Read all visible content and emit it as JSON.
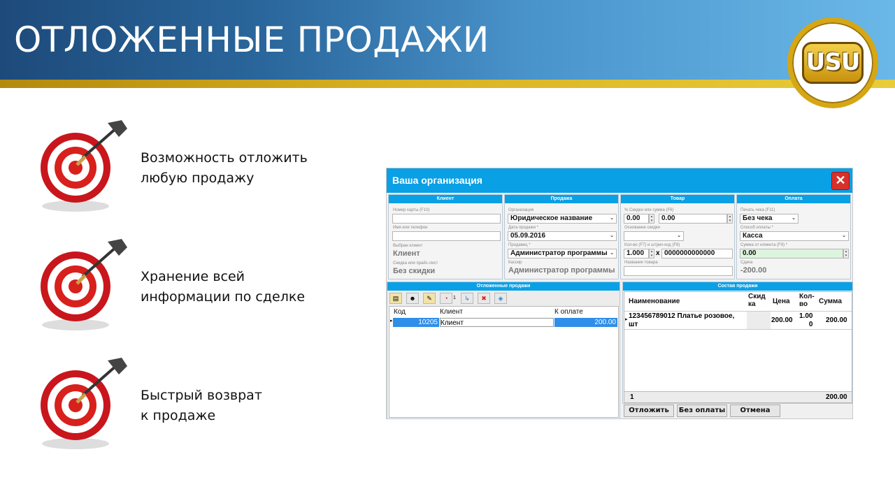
{
  "slide": {
    "title": "ОТЛОЖЕННЫЕ ПРОДАЖИ",
    "logo_text": "USU",
    "features": [
      {
        "line1": "Возможность отложить",
        "line2": "любую продажу"
      },
      {
        "line1": "Хранение всей",
        "line2": "информации по сделке"
      },
      {
        "line1": "Быстрый возврат",
        "line2": "к продаже"
      }
    ]
  },
  "app": {
    "title": "Ваша организация",
    "close_icon": "✕",
    "client": {
      "header": "Клиент",
      "card_label": "Номер карты (F10)",
      "card_value": "",
      "name_label": "Имя или телефон",
      "name_value": "",
      "selected_label": "Выбран клиент",
      "selected_value": "Клиент",
      "discount_label": "Скидка или прайс-лист",
      "discount_value": "Без скидки"
    },
    "sale": {
      "header": "Продажа",
      "org_label": "Организация",
      "org_value": "Юридическое название",
      "date_label": "Дата продажи *",
      "date_value": "05.09.2016",
      "seller_label": "Продавец *",
      "seller_value": "Администратор программы",
      "cashier_label": "Кассир",
      "cashier_value": "Администратор программы"
    },
    "goods": {
      "header": "Товар",
      "discount_label": "% Скидки или сумма (F6)",
      "discount_pct": "0.00",
      "discount_sum": "0.00",
      "reason_label": "Основание скидки",
      "reason_value": "",
      "qty_label": "Кол-во (F7) и штрих-код (F8)",
      "qty_value": "1.000",
      "barcode_value": "0000000000000",
      "name_label": "Название товара",
      "name_value": ""
    },
    "payment": {
      "header": "Оплата",
      "print_label": "Печать чека (F11)",
      "print_value": "Без чека",
      "method_label": "Способ оплаты *",
      "method_value": "Касса",
      "amount_label": "Сумма от клиента (F9) *",
      "amount_value": "0.00",
      "change_label": "Сдача",
      "change_value": "-200.00"
    },
    "deferred": {
      "header": "Отложенные продажи",
      "toolbar_count": "1",
      "columns": [
        "Код",
        "Клиент",
        "К оплате"
      ],
      "rows": [
        {
          "code": "10205",
          "client": "Клиент",
          "amount": "200.00"
        }
      ]
    },
    "composition": {
      "header": "Состав продажи",
      "columns": [
        "Наименование",
        "Скид\nка",
        "Цена",
        "Кол-\nво",
        "Сумма"
      ],
      "rows": [
        {
          "name": "123456789012 Платье розовое,\nшт",
          "discount": "",
          "price": "200.00",
          "qty": "1.00\n0",
          "sum": "200.00"
        }
      ],
      "total_count": "1",
      "total_sum": "200.00"
    },
    "buttons": {
      "defer": "Отложить",
      "no_pay": "Без оплаты",
      "cancel": "Отмена"
    }
  }
}
